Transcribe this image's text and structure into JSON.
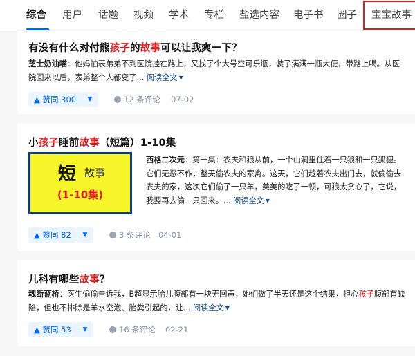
{
  "tabs": [
    {
      "label": "综合",
      "active": true
    },
    {
      "label": "用户"
    },
    {
      "label": "话题"
    },
    {
      "label": "视频"
    },
    {
      "label": "学术"
    },
    {
      "label": "专栏"
    },
    {
      "label": "盐选内容"
    },
    {
      "label": "电子书"
    },
    {
      "label": "圈子"
    },
    {
      "label": "宝宝故事"
    }
  ],
  "cards": [
    {
      "title_parts": [
        "有没有什么对付熊",
        "孩子",
        "的",
        "故事",
        "可以让我爽一下？"
      ],
      "author": "芝士奶油喵",
      "excerpt": "：他妈怕表弟弟不到医院挂在路上，又找了个大号空可乐瓶，装了满满一瓶大便，带路上喝。从医院回来以后，表弟整个人都变了...",
      "read_more": "阅读全文",
      "vote_label": "▲ 赞同 300",
      "comments": "12 条评论",
      "date": "07-02"
    },
    {
      "title_parts": [
        "小",
        "孩子",
        "睡前",
        "故事",
        "（短篇）1-10集"
      ],
      "thumbnail": {
        "big": "短",
        "small": "故事",
        "range": "(1-10集)"
      },
      "author": "西格二次元",
      "excerpt": "：第一集：农夫和狼从前，一个山洞里住着一只狼和一只狐狸。它们无恶不作，整天偷农夫的家禽。这天，它们趁着农夫出门去，就偷偷去农夫的家，这次它们偷了一只羊，美美的吃了一顿，可狼太贪心了，它说，我要再去偷一只回来。...",
      "read_more": "阅读全文",
      "vote_label": "▲ 赞同 82",
      "comments": "3 条评论",
      "date": "04-01"
    },
    {
      "title_parts": [
        "儿科有哪些",
        "故事",
        "？"
      ],
      "author": "魂断蓝桥",
      "excerpt_before": "：医生偷偷告诉我，B超显示胎儿腹部有一块无回声，她们做了半天还是这个结果，担心",
      "excerpt_hl": "孩子",
      "excerpt": "腹部有缺陷，但也不排除是羊水空泡、胎粪引起的，让...",
      "read_more": "阅读全文",
      "vote_label": "▲ 赞同 53",
      "comments": "16 条评论",
      "date": "02-21"
    }
  ],
  "icons": {
    "down_vote": "triangle-down",
    "comment": "comment-bubble",
    "expand": "chevron-down"
  },
  "colors": {
    "accent": "#0066ff",
    "highlight": "#e02020",
    "tab_box": "#e02020"
  }
}
